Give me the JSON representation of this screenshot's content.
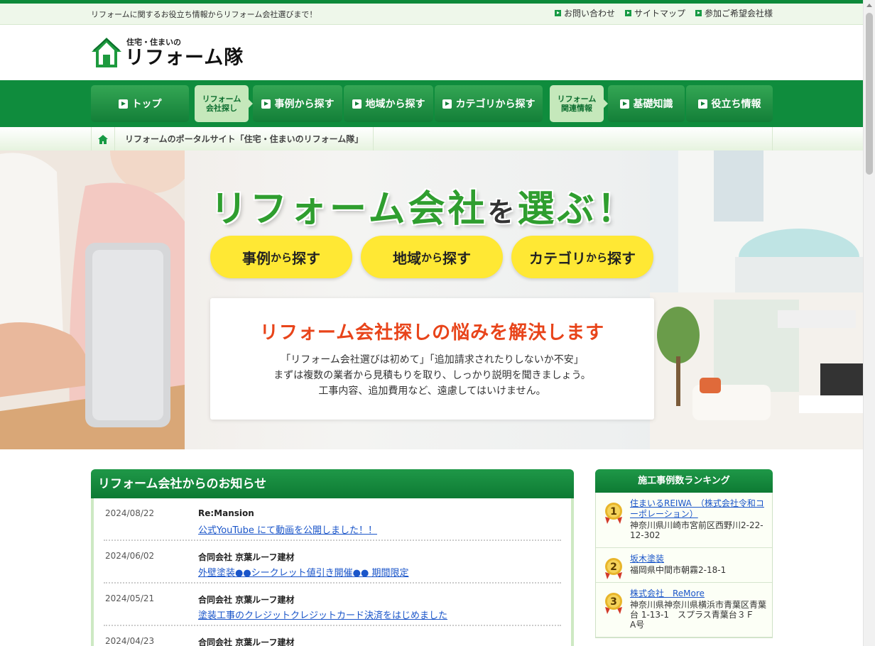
{
  "util": {
    "tagline": "リフォームに関するお役立ち情報からリフォーム会社選びまで！",
    "links": [
      "お問い合わせ",
      "サイトマップ",
      "参加ご希望会社様"
    ]
  },
  "logo": {
    "sub": "住宅・住まいの",
    "main": "リフォーム隊"
  },
  "nav": {
    "top": "トップ",
    "label1": "リフォーム\n会社探し",
    "case": "事例から探す",
    "area": "地域から探す",
    "category": "カテゴリから探す",
    "label2": "リフォーム\n関連情報",
    "basic": "基礎知識",
    "useful": "役立ち情報"
  },
  "breadcrumb": {
    "current": "リフォームのポータルサイト「住宅・住まいのリフォーム隊」"
  },
  "hero": {
    "title_a": "リフォーム会社",
    "title_b": "を",
    "title_c": "選ぶ！",
    "pills": [
      {
        "a": "事例",
        "b": "から",
        "c": "探す"
      },
      {
        "a": "地域",
        "b": "から",
        "c": "探す"
      },
      {
        "a": "カテゴリ",
        "b": "から",
        "c": "探す"
      }
    ],
    "box_title": "リフォーム会社探しの悩みを解決します",
    "box_lines": [
      "「リフォーム会社選びは初めて」「追加請求されたりしないか不安」",
      "まずは複数の業者から見積もりを取り、しっかり説明を聞きましょう。",
      "工事内容、追加費用など、遠慮してはいけません。"
    ]
  },
  "news": {
    "title": "リフォーム会社からのお知らせ",
    "items": [
      {
        "date": "2024/08/22",
        "company": "Re:Mansion",
        "link": "公式YouTube にて動画を公開しました！！"
      },
      {
        "date": "2024/06/02",
        "company": "合同会社 京葉ルーフ建材",
        "link": "外壁塗装●●シークレット値引き開催●● 期間限定"
      },
      {
        "date": "2024/05/21",
        "company": "合同会社 京葉ルーフ建材",
        "link": "塗装工事のクレジットクレジットカード決済をはじめました"
      },
      {
        "date": "2024/04/23",
        "company": "合同会社 京葉ルーフ建材",
        "link": ""
      }
    ]
  },
  "ranking": {
    "title": "施工事例数ランキング",
    "items": [
      {
        "rank": "1",
        "name": "住まいるREIWA　（株式会社令和コーポレーション）",
        "addr": "神奈川県川崎市宮前区西野川2-22-12-302"
      },
      {
        "rank": "2",
        "name": "坂木塗装",
        "addr": "福岡県中間市朝霧2-18-1"
      },
      {
        "rank": "3",
        "name": "株式会社　ReMore",
        "addr": "神奈川県神奈川県横浜市青葉区青葉台 1-13-1　スプラス青葉台３Ｆ　A号"
      }
    ]
  },
  "colors": {
    "brand_green": "#0f8c3d",
    "accent_yellow": "#ffe834",
    "accent_orange": "#e8441a",
    "link": "#1a55c9"
  }
}
